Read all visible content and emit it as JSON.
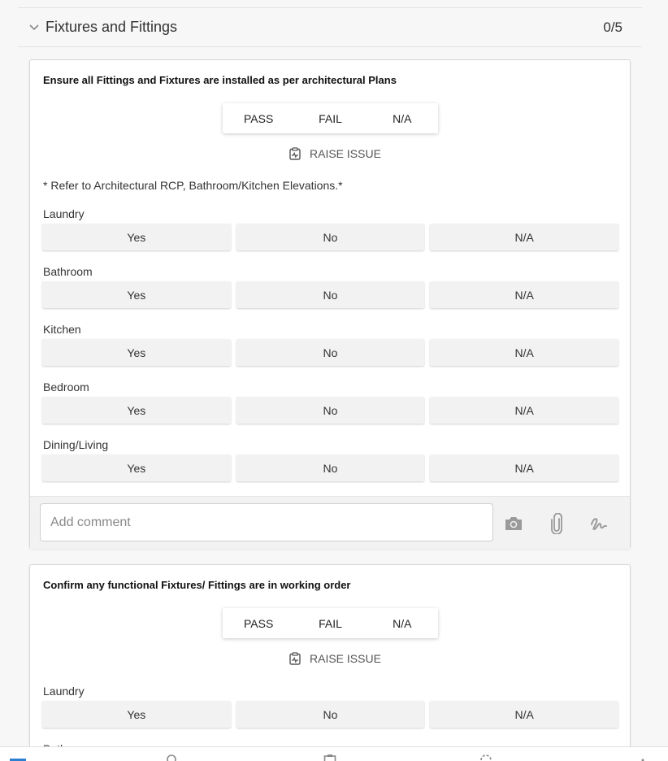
{
  "section": {
    "title": "Fixtures and Fittings",
    "count": "0/5"
  },
  "pass_fail": {
    "pass": "PASS",
    "fail": "FAIL",
    "na": "N/A"
  },
  "raise_issue_label": "RAISE ISSUE",
  "options": {
    "yes": "Yes",
    "no": "No",
    "na": "N/A"
  },
  "questions": [
    {
      "title": "Ensure all Fittings and Fixtures are installed as per architectural Plans",
      "note": "* Refer to Architectural RCP, Bathroom/Kitchen Elevations.*",
      "rows": [
        "Laundry",
        "Bathroom",
        "Kitchen",
        "Bedroom",
        "Dining/Living"
      ],
      "comment_placeholder": "Add comment"
    },
    {
      "title": "Confirm any functional Fixtures/ Fittings are in working order",
      "rows": [
        "Laundry",
        "Bathroom"
      ]
    }
  ],
  "icons": {
    "collapse": "chevron-down-icon",
    "raise_issue": "clipboard-pulse-icon",
    "camera": "camera-icon",
    "attach": "paperclip-icon",
    "signature": "signature-icon"
  },
  "colors": {
    "accent": "#2f7fd1",
    "option_bg": "#f2f2f3",
    "comment_bar": "#f2f2f2"
  }
}
